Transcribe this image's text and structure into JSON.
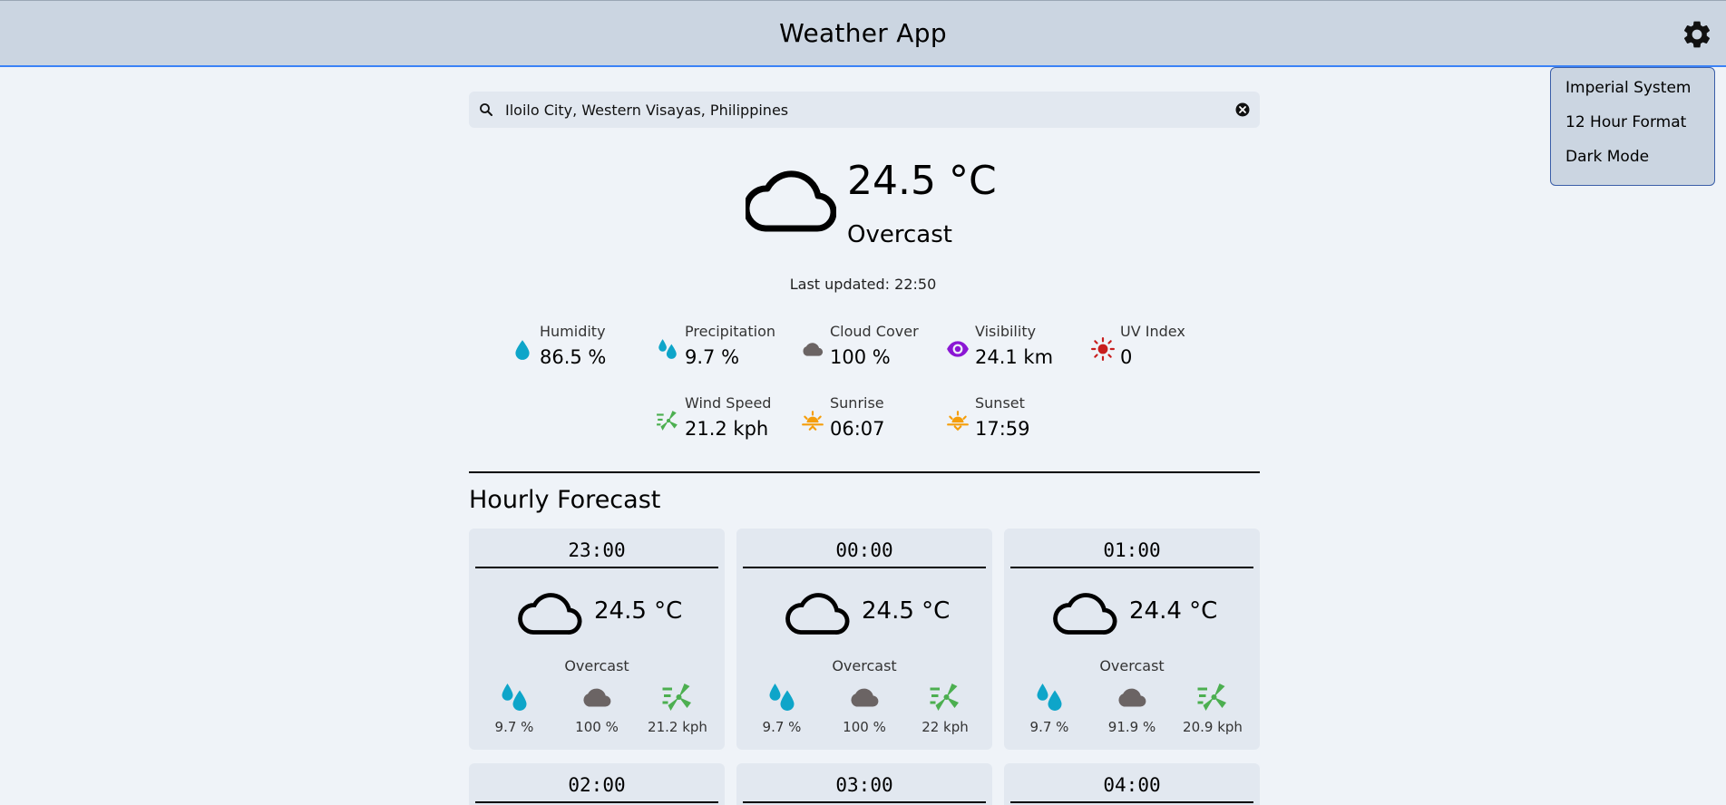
{
  "header": {
    "title": "Weather App",
    "settings_icon": "gear-icon"
  },
  "settings_menu": {
    "items": [
      "Imperial System",
      "12 Hour Format",
      "Dark Mode"
    ]
  },
  "search": {
    "value": "Iloilo City, Western Visayas, Philippines",
    "icon": "search-icon",
    "clear_icon": "clear-icon"
  },
  "current": {
    "temperature": "24.5 °C",
    "condition": "Overcast",
    "icon": "cloud-icon",
    "last_updated": "Last updated: 22:50"
  },
  "stats": [
    {
      "label": "Humidity",
      "value": "86.5 %",
      "icon": "humidity-drop-icon",
      "color": "#0ea5c9"
    },
    {
      "label": "Precipitation",
      "value": "9.7 %",
      "icon": "precipitation-drops-icon",
      "color": "#0ea5c9"
    },
    {
      "label": "Cloud Cover",
      "value": "100 %",
      "icon": "cloud-cover-icon",
      "color": "#6b6464"
    },
    {
      "label": "Visibility",
      "value": "24.1 km",
      "icon": "eye-icon",
      "color": "#8b16d4"
    },
    {
      "label": "UV Index",
      "value": "0",
      "icon": "uv-sun-icon",
      "color": "#c81e1e"
    },
    {
      "label": "Wind Speed",
      "value": "21.2 kph",
      "icon": "wind-icon",
      "color": "#4caf50"
    },
    {
      "label": "Sunrise",
      "value": "06:07",
      "icon": "sunrise-icon",
      "color": "#f59e0b"
    },
    {
      "label": "Sunset",
      "value": "17:59",
      "icon": "sunset-icon",
      "color": "#f59e0b"
    }
  ],
  "hourly": {
    "title": "Hourly Forecast",
    "cards": [
      {
        "time": "23:00",
        "temp": "24.5 °C",
        "condition": "Overcast",
        "precip": "9.7 %",
        "cloud": "100 %",
        "wind": "21.2 kph"
      },
      {
        "time": "00:00",
        "temp": "24.5 °C",
        "condition": "Overcast",
        "precip": "9.7 %",
        "cloud": "100 %",
        "wind": "22 kph"
      },
      {
        "time": "01:00",
        "temp": "24.4 °C",
        "condition": "Overcast",
        "precip": "9.7 %",
        "cloud": "91.9 %",
        "wind": "20.9 kph"
      },
      {
        "time": "02:00"
      },
      {
        "time": "03:00"
      },
      {
        "time": "04:00"
      }
    ]
  }
}
